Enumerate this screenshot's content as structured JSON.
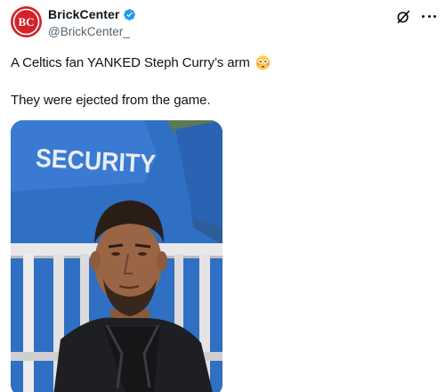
{
  "post": {
    "author": {
      "display_name": "BrickCenter",
      "handle": "@BrickCenter_",
      "avatar_text": "BC",
      "avatar_color": "#d2232a",
      "verified_badge_color": "#1d9bf0"
    },
    "text_line_1": "A Celtics fan YANKED Steph Curry’s arm",
    "emoji": "flushed-face",
    "text_line_2": "They were ejected from the game.",
    "media": {
      "type": "video-thumbnail",
      "security_text": "SECURITY"
    },
    "actions": {
      "grok_icon": "grok-icon",
      "more_icon": "more-icon"
    }
  }
}
